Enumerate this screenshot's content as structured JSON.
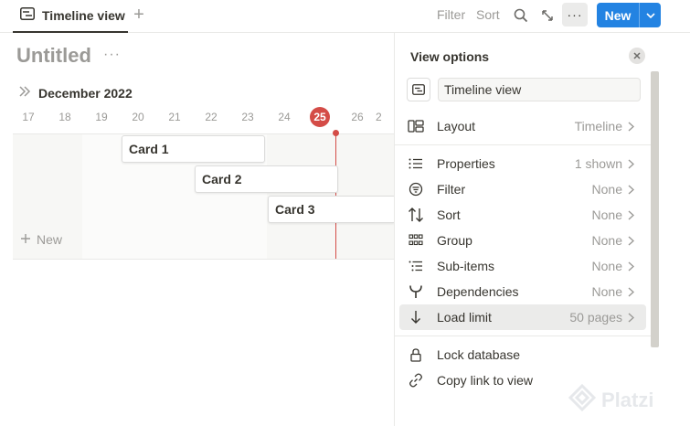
{
  "topbar": {
    "tab_label": "Timeline view",
    "filter_label": "Filter",
    "sort_label": "Sort",
    "more_label": "···",
    "new_label": "New"
  },
  "page": {
    "title": "Untitled",
    "month": "December 2022",
    "days": [
      "17",
      "18",
      "19",
      "20",
      "21",
      "22",
      "23",
      "24",
      "25",
      "26",
      "2"
    ],
    "today": "25",
    "cards": [
      "Card 1",
      "Card 2",
      "Card 3"
    ],
    "add_new_label": "New"
  },
  "panel": {
    "title": "View options",
    "view_name": "Timeline view",
    "layout": {
      "label": "Layout",
      "value": "Timeline"
    },
    "options": [
      {
        "label": "Properties",
        "value": "1 shown",
        "icon": "list-icon"
      },
      {
        "label": "Filter",
        "value": "None",
        "icon": "filter-icon"
      },
      {
        "label": "Sort",
        "value": "None",
        "icon": "sort-icon"
      },
      {
        "label": "Group",
        "value": "None",
        "icon": "group-icon"
      },
      {
        "label": "Sub-items",
        "value": "None",
        "icon": "sub-items-icon"
      },
      {
        "label": "Dependencies",
        "value": "None",
        "icon": "dependencies-icon"
      },
      {
        "label": "Load limit",
        "value": "50 pages",
        "icon": "arrow-down-icon"
      }
    ],
    "actions": [
      {
        "label": "Lock database",
        "icon": "lock-icon"
      },
      {
        "label": "Copy link to view",
        "icon": "link-icon"
      }
    ]
  },
  "watermark": {
    "text": "Platzi"
  },
  "colors": {
    "accent": "#2383e2",
    "today": "#d44c47",
    "muted": "#9b9a97",
    "text": "#37352f"
  }
}
